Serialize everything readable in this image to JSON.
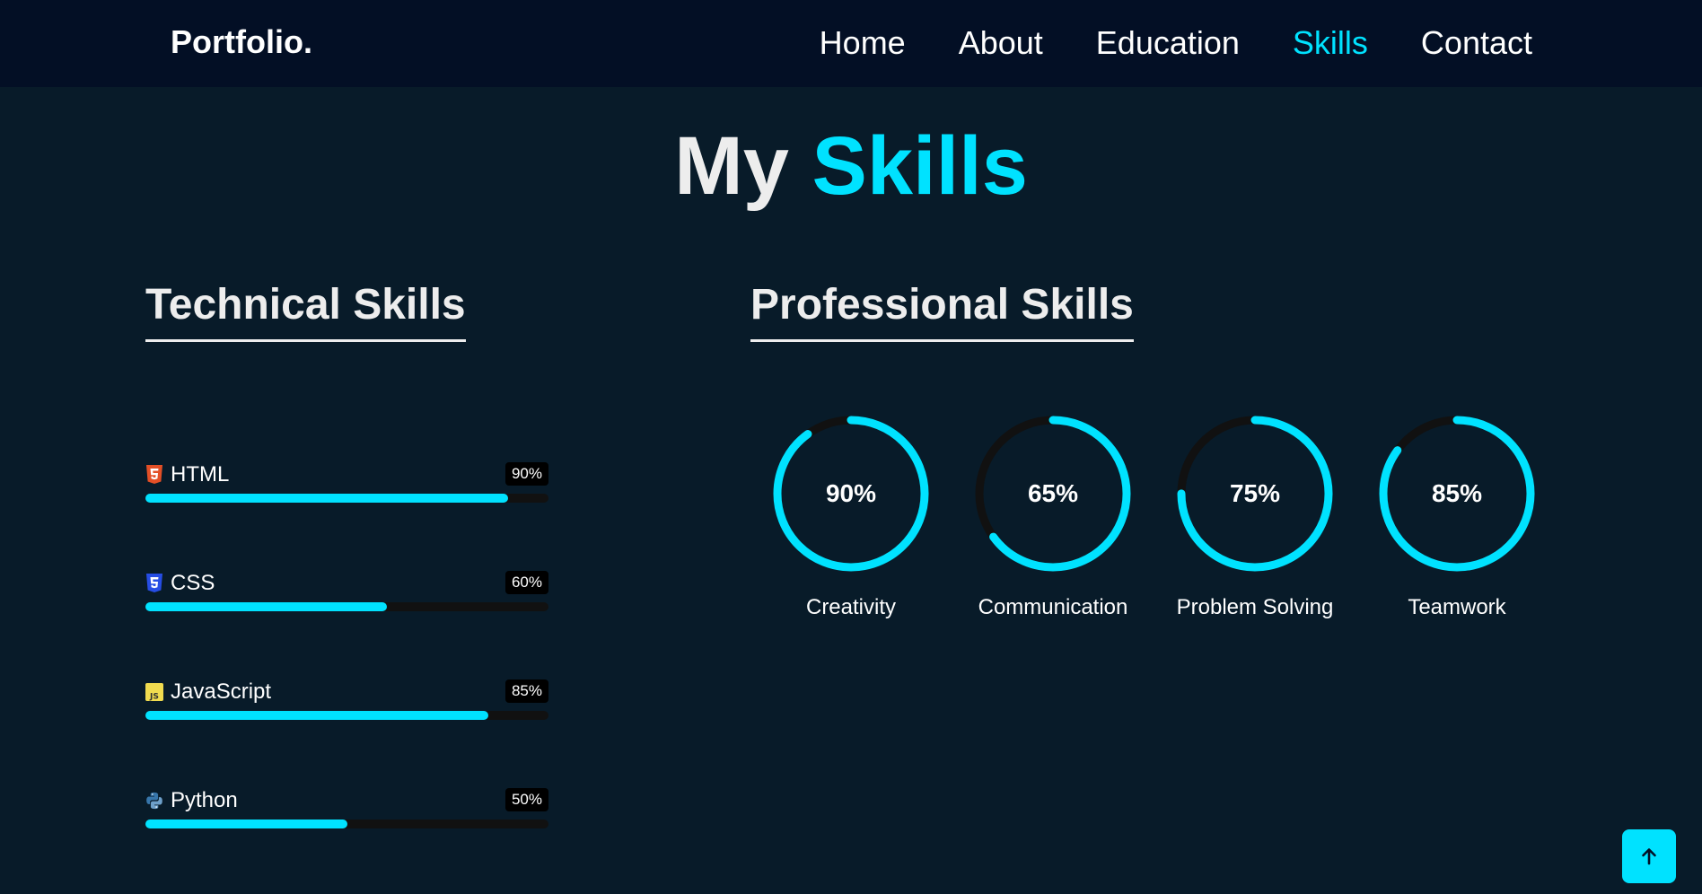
{
  "header": {
    "logo": "Portfolio.",
    "nav": [
      {
        "label": "Home",
        "active": false
      },
      {
        "label": "About",
        "active": false
      },
      {
        "label": "Education",
        "active": false
      },
      {
        "label": "Skills",
        "active": true
      },
      {
        "label": "Contact",
        "active": false
      }
    ]
  },
  "title": {
    "part1": "My",
    "part2": "Skills"
  },
  "technical": {
    "heading": "Technical Skills",
    "items": [
      {
        "name": "HTML",
        "percent": "90%",
        "value": 90,
        "icon": "html5-icon",
        "icon_color": "#e34f26"
      },
      {
        "name": "CSS",
        "percent": "60%",
        "value": 60,
        "icon": "css3-icon",
        "icon_color": "#264de4"
      },
      {
        "name": "JavaScript",
        "percent": "85%",
        "value": 85,
        "icon": "javascript-icon",
        "icon_color": "#f0db4f"
      },
      {
        "name": "Python",
        "percent": "50%",
        "value": 50,
        "icon": "python-icon",
        "icon_color": "#3776ab"
      }
    ]
  },
  "professional": {
    "heading": "Professional Skills",
    "items": [
      {
        "name": "Creativity",
        "percent": "90%",
        "value": 90
      },
      {
        "name": "Communication",
        "percent": "65%",
        "value": 65
      },
      {
        "name": "Problem Solving",
        "percent": "75%",
        "value": 75
      },
      {
        "name": "Teamwork",
        "percent": "85%",
        "value": 85
      }
    ]
  },
  "colors": {
    "accent": "#00e2ff",
    "background": "#081b29",
    "header_bg": "#030f25",
    "track": "#111111"
  },
  "scroll_top": {
    "icon": "arrow-up-icon"
  }
}
